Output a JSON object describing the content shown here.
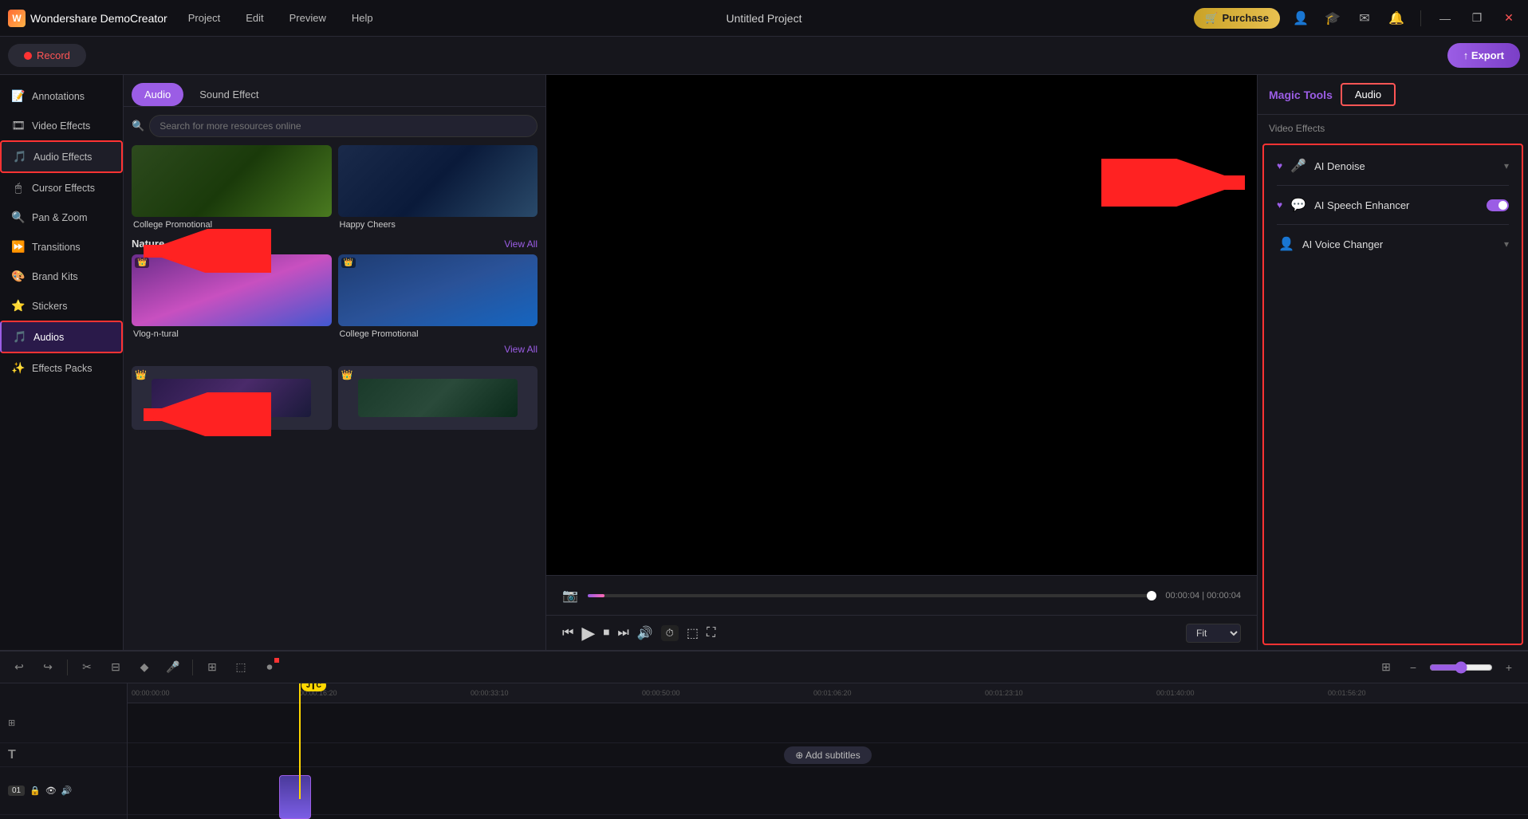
{
  "app": {
    "name": "Wondershare DemoCreator",
    "project_title": "Untitled Project"
  },
  "topbar": {
    "nav": [
      "Project",
      "Edit",
      "Preview",
      "Help"
    ],
    "purchase_label": "Purchase",
    "export_label": "↑ Export",
    "record_label": "Record",
    "window_controls": [
      "—",
      "❐",
      "✕"
    ]
  },
  "sidebar": {
    "items": [
      {
        "icon": "📝",
        "label": "Annotations"
      },
      {
        "icon": "🎞",
        "label": "Video Effects"
      },
      {
        "icon": "🎵",
        "label": "Audio Effects",
        "active": true
      },
      {
        "icon": "🖱",
        "label": "Cursor Effects"
      },
      {
        "icon": "🔍",
        "label": "Pan & Zoom"
      },
      {
        "icon": "⏩",
        "label": "Transitions"
      },
      {
        "icon": "🎨",
        "label": "Brand Kits"
      },
      {
        "icon": "⭐",
        "label": "Stickers"
      },
      {
        "icon": "🎵",
        "label": "Audios",
        "highlighted": true
      },
      {
        "icon": "✨",
        "label": "Effects Packs"
      }
    ]
  },
  "media_panel": {
    "tabs": [
      "Audio",
      "Sound Effect"
    ],
    "active_tab": "Audio",
    "search_placeholder": "Search for more resources online",
    "sections": [
      {
        "title": "",
        "items": [
          {
            "label": "College Promotional",
            "type": "college"
          },
          {
            "label": "Happy Cheers",
            "type": "happy"
          }
        ]
      },
      {
        "title": "Nature",
        "view_all": "View All",
        "items": [
          {
            "label": "Vlog-n-tural",
            "type": "vlog",
            "crown": true
          },
          {
            "label": "College Promotional",
            "type": "college2",
            "crown": true
          }
        ]
      }
    ]
  },
  "magic_tools": {
    "label": "Magic Tools",
    "audio_tab_label": "Audio",
    "section_title": "Video Effects",
    "effects": [
      {
        "name": "AI Denoise",
        "icon": "🎤",
        "has_heart": true,
        "expandable": true
      },
      {
        "name": "AI Speech Enhancer",
        "icon": "💬",
        "has_heart": true,
        "toggle": true,
        "toggle_on": true
      },
      {
        "name": "AI Voice Changer",
        "icon": "👤",
        "expandable": true
      }
    ]
  },
  "preview": {
    "time_current": "00:00:04",
    "time_total": "00:00:04"
  },
  "timeline": {
    "ruler_marks": [
      "00:00:00:00",
      "00:00:16:20",
      "00:00:33:10",
      "00:00:50:00",
      "00:01:06:20",
      "00:01:23:10",
      "00:01:40:00",
      "00:01:56:20"
    ],
    "add_subtitles_label": "⊕ Add subtitles",
    "zoom_label": "Fit"
  },
  "colors": {
    "accent": "#9b5de5",
    "red": "#ff3333",
    "gold": "#ffd700",
    "bg_dark": "#111116",
    "bg_mid": "#16161c",
    "bg_panel": "#18181f"
  }
}
